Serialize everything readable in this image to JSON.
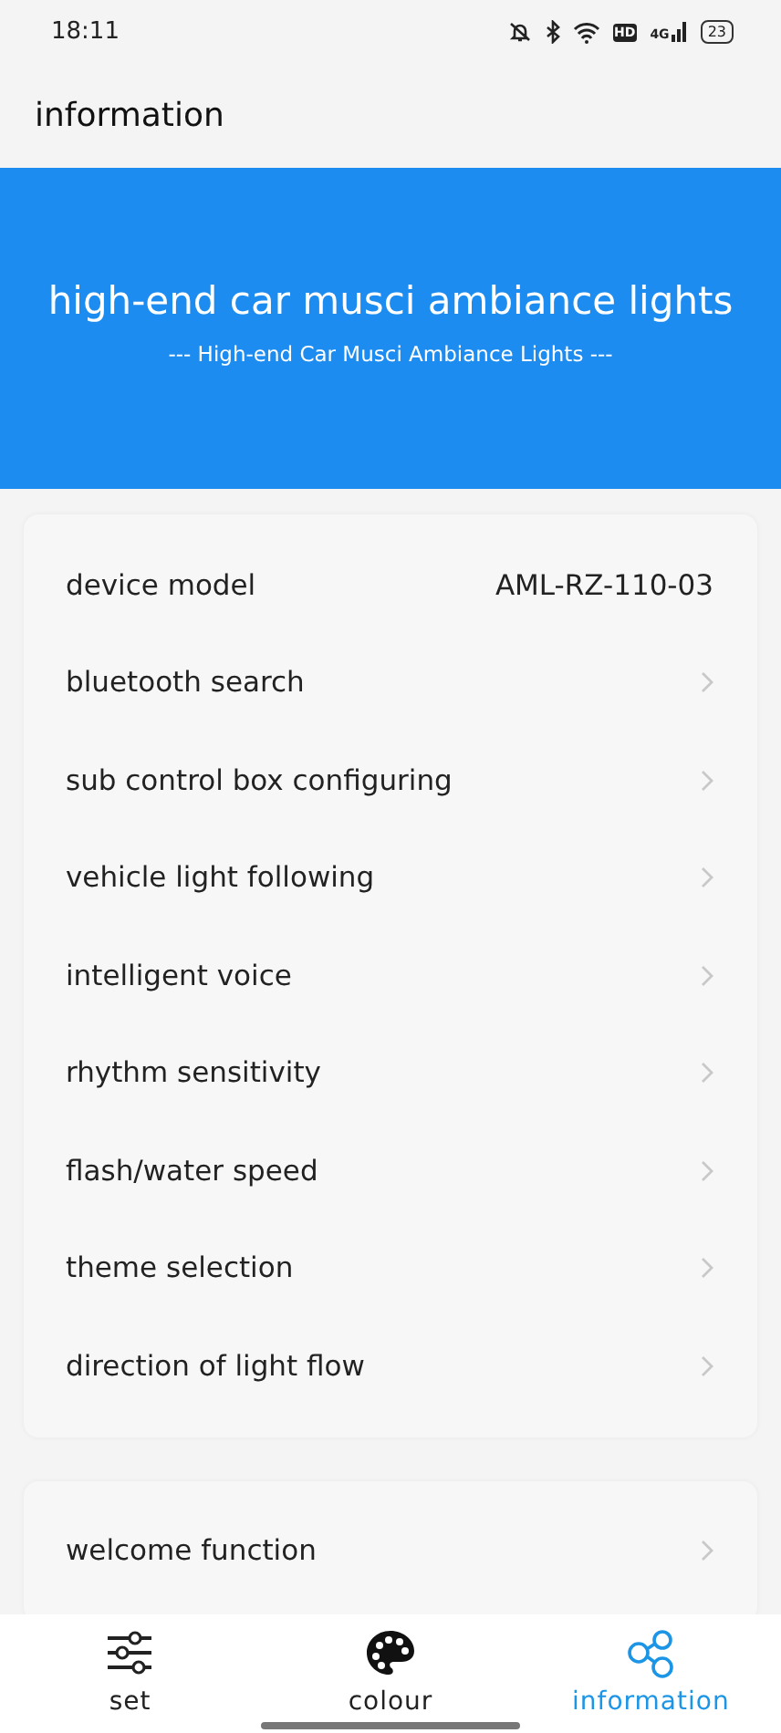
{
  "status_bar": {
    "time": "18:11",
    "hd": "HD",
    "network": "4G",
    "battery": "23"
  },
  "header": {
    "title": "information"
  },
  "banner": {
    "title": "high-end car musci ambiance lights",
    "subtitle": "--- High-end Car Musci Ambiance Lights ---"
  },
  "groups": [
    {
      "rows": [
        {
          "kind": "value",
          "label": "device model",
          "value": "AML-RZ-110-03"
        },
        {
          "kind": "link",
          "label": "bluetooth search"
        },
        {
          "kind": "link",
          "label": "sub control box configuring"
        },
        {
          "kind": "link",
          "label": "vehicle light following"
        },
        {
          "kind": "link",
          "label": "intelligent voice"
        },
        {
          "kind": "link",
          "label": "rhythm sensitivity"
        },
        {
          "kind": "link",
          "label": "flash/water speed"
        },
        {
          "kind": "link",
          "label": "theme selection"
        },
        {
          "kind": "link",
          "label": "direction of light flow"
        }
      ]
    },
    {
      "rows": [
        {
          "kind": "link",
          "label": "welcome function"
        }
      ]
    }
  ],
  "nav": [
    {
      "kind": "sliders",
      "label": "set",
      "selected": false
    },
    {
      "kind": "palette",
      "label": "colour",
      "selected": false
    },
    {
      "kind": "share",
      "label": "information",
      "selected": true
    }
  ]
}
